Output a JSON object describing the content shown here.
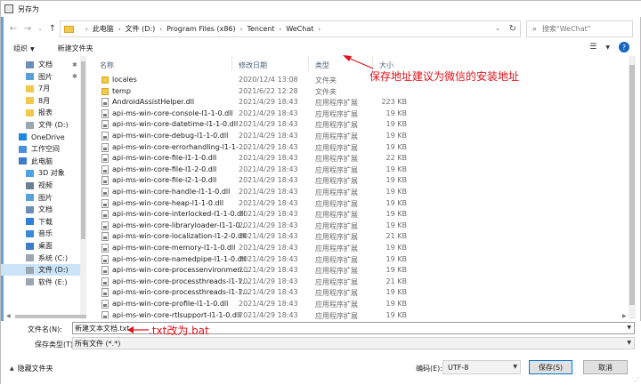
{
  "window": {
    "title": "另存为"
  },
  "address": {
    "crumbs": [
      "此电脑",
      "文件 (D:)",
      "Program Files (x86)",
      "Tencent",
      "WeChat"
    ],
    "search_placeholder": "搜索\"WeChat\""
  },
  "toolbar": {
    "organize": "组织",
    "new_folder": "新建文件夹"
  },
  "sidebar": {
    "items": [
      {
        "label": "文档",
        "icon": "document-icon",
        "pinned": true
      },
      {
        "label": "图片",
        "icon": "picture-icon",
        "pinned": true
      },
      {
        "label": "7月",
        "icon": "folder-icon",
        "pinned": false
      },
      {
        "label": "8月",
        "icon": "folder-icon",
        "pinned": false
      },
      {
        "label": "报表",
        "icon": "folder-icon",
        "pinned": false
      },
      {
        "label": "文件 (D:)",
        "icon": "drive-icon",
        "pinned": false
      },
      {
        "label": "OneDrive",
        "icon": "cloud-icon",
        "pinned": false
      },
      {
        "label": "工作空间",
        "icon": "workspace-icon",
        "pinned": false
      },
      {
        "label": "此电脑",
        "icon": "computer-icon",
        "pinned": false
      },
      {
        "label": "3D 对象",
        "icon": "3d-icon",
        "pinned": false
      },
      {
        "label": "视频",
        "icon": "video-icon",
        "pinned": false
      },
      {
        "label": "图片",
        "icon": "picture-icon",
        "pinned": false
      },
      {
        "label": "文档",
        "icon": "document-icon",
        "pinned": false
      },
      {
        "label": "下载",
        "icon": "download-icon",
        "pinned": false
      },
      {
        "label": "音乐",
        "icon": "music-icon",
        "pinned": false
      },
      {
        "label": "桌面",
        "icon": "desktop-icon",
        "pinned": false
      },
      {
        "label": "系统 (C:)",
        "icon": "drive-icon",
        "pinned": false
      },
      {
        "label": "文件 (D:)",
        "icon": "drive-icon",
        "pinned": false,
        "selected": true
      },
      {
        "label": "软件 (E:)",
        "icon": "drive-icon",
        "pinned": false
      }
    ]
  },
  "columns": {
    "name": "名称",
    "date": "修改日期",
    "type": "类型",
    "size": "大小"
  },
  "files": [
    {
      "name": "locales",
      "date": "2020/12/4 13:08",
      "type": "文件夹",
      "size": "",
      "kind": "folder"
    },
    {
      "name": "temp",
      "date": "2021/6/22 12:28",
      "type": "文件夹",
      "size": "",
      "kind": "folder"
    },
    {
      "name": "AndroidAssistHelper.dll",
      "date": "2021/4/29 18:43",
      "type": "应用程序扩展",
      "size": "223 KB",
      "kind": "dll"
    },
    {
      "name": "api-ms-win-core-console-l1-1-0.dll",
      "date": "2021/4/29 18:43",
      "type": "应用程序扩展",
      "size": "19 KB",
      "kind": "dll"
    },
    {
      "name": "api-ms-win-core-datetime-l1-1-0.dll",
      "date": "2021/4/29 18:43",
      "type": "应用程序扩展",
      "size": "19 KB",
      "kind": "dll"
    },
    {
      "name": "api-ms-win-core-debug-l1-1-0.dll",
      "date": "2021/4/29 18:43",
      "type": "应用程序扩展",
      "size": "19 KB",
      "kind": "dll"
    },
    {
      "name": "api-ms-win-core-errorhandling-l1-1-...",
      "date": "2021/4/29 18:43",
      "type": "应用程序扩展",
      "size": "19 KB",
      "kind": "dll"
    },
    {
      "name": "api-ms-win-core-file-l1-1-0.dll",
      "date": "2021/4/29 18:43",
      "type": "应用程序扩展",
      "size": "22 KB",
      "kind": "dll"
    },
    {
      "name": "api-ms-win-core-file-l1-2-0.dll",
      "date": "2021/4/29 18:43",
      "type": "应用程序扩展",
      "size": "19 KB",
      "kind": "dll"
    },
    {
      "name": "api-ms-win-core-file-l2-1-0.dll",
      "date": "2021/4/29 18:43",
      "type": "应用程序扩展",
      "size": "19 KB",
      "kind": "dll"
    },
    {
      "name": "api-ms-win-core-handle-l1-1-0.dll",
      "date": "2021/4/29 18:43",
      "type": "应用程序扩展",
      "size": "19 KB",
      "kind": "dll"
    },
    {
      "name": "api-ms-win-core-heap-l1-1-0.dll",
      "date": "2021/4/29 18:43",
      "type": "应用程序扩展",
      "size": "19 KB",
      "kind": "dll"
    },
    {
      "name": "api-ms-win-core-interlocked-l1-1-0.dll",
      "date": "2021/4/29 18:43",
      "type": "应用程序扩展",
      "size": "19 KB",
      "kind": "dll"
    },
    {
      "name": "api-ms-win-core-libraryloader-l1-1-0...",
      "date": "2021/4/29 18:43",
      "type": "应用程序扩展",
      "size": "19 KB",
      "kind": "dll"
    },
    {
      "name": "api-ms-win-core-localization-l1-2-0.dll",
      "date": "2021/4/29 18:43",
      "type": "应用程序扩展",
      "size": "21 KB",
      "kind": "dll"
    },
    {
      "name": "api-ms-win-core-memory-l1-1-0.dll",
      "date": "2021/4/29 18:43",
      "type": "应用程序扩展",
      "size": "19 KB",
      "kind": "dll"
    },
    {
      "name": "api-ms-win-core-namedpipe-l1-1-0.dll",
      "date": "2021/4/29 18:43",
      "type": "应用程序扩展",
      "size": "19 KB",
      "kind": "dll"
    },
    {
      "name": "api-ms-win-core-processenvironmen...",
      "date": "2021/4/29 18:43",
      "type": "应用程序扩展",
      "size": "19 KB",
      "kind": "dll"
    },
    {
      "name": "api-ms-win-core-processthreads-l1-1...",
      "date": "2021/4/29 18:43",
      "type": "应用程序扩展",
      "size": "21 KB",
      "kind": "dll"
    },
    {
      "name": "api-ms-win-core-processthreads-l1-1...",
      "date": "2021/4/29 18:43",
      "type": "应用程序扩展",
      "size": "19 KB",
      "kind": "dll"
    },
    {
      "name": "api-ms-win-core-profile-l1-1-0.dll",
      "date": "2021/4/29 18:43",
      "type": "应用程序扩展",
      "size": "19 KB",
      "kind": "dll"
    },
    {
      "name": "api-ms-win-core-rtlsupport-l1-1-0.dll",
      "date": "2021/4/29 18:43",
      "type": "应用程序扩展",
      "size": "19 KB",
      "kind": "dll"
    }
  ],
  "filename": {
    "label": "文件名(N):",
    "value": "新建文本文档.txt"
  },
  "savetype": {
    "label": "保存类型(T):",
    "value": "所有文件 (*.*)"
  },
  "hide_folders": "隐藏文件夹",
  "encoding": {
    "label": "编码(E):",
    "value": "UTF-8"
  },
  "buttons": {
    "save": "保存(S)",
    "cancel": "取消"
  },
  "annotations": {
    "top": "保存地址建议为微信的安装地址",
    "bottom": ".txt改为.bat"
  },
  "colors": {
    "annotation": "#e0121b",
    "selection": "#cce4f7",
    "folder": "#f2c94c"
  }
}
